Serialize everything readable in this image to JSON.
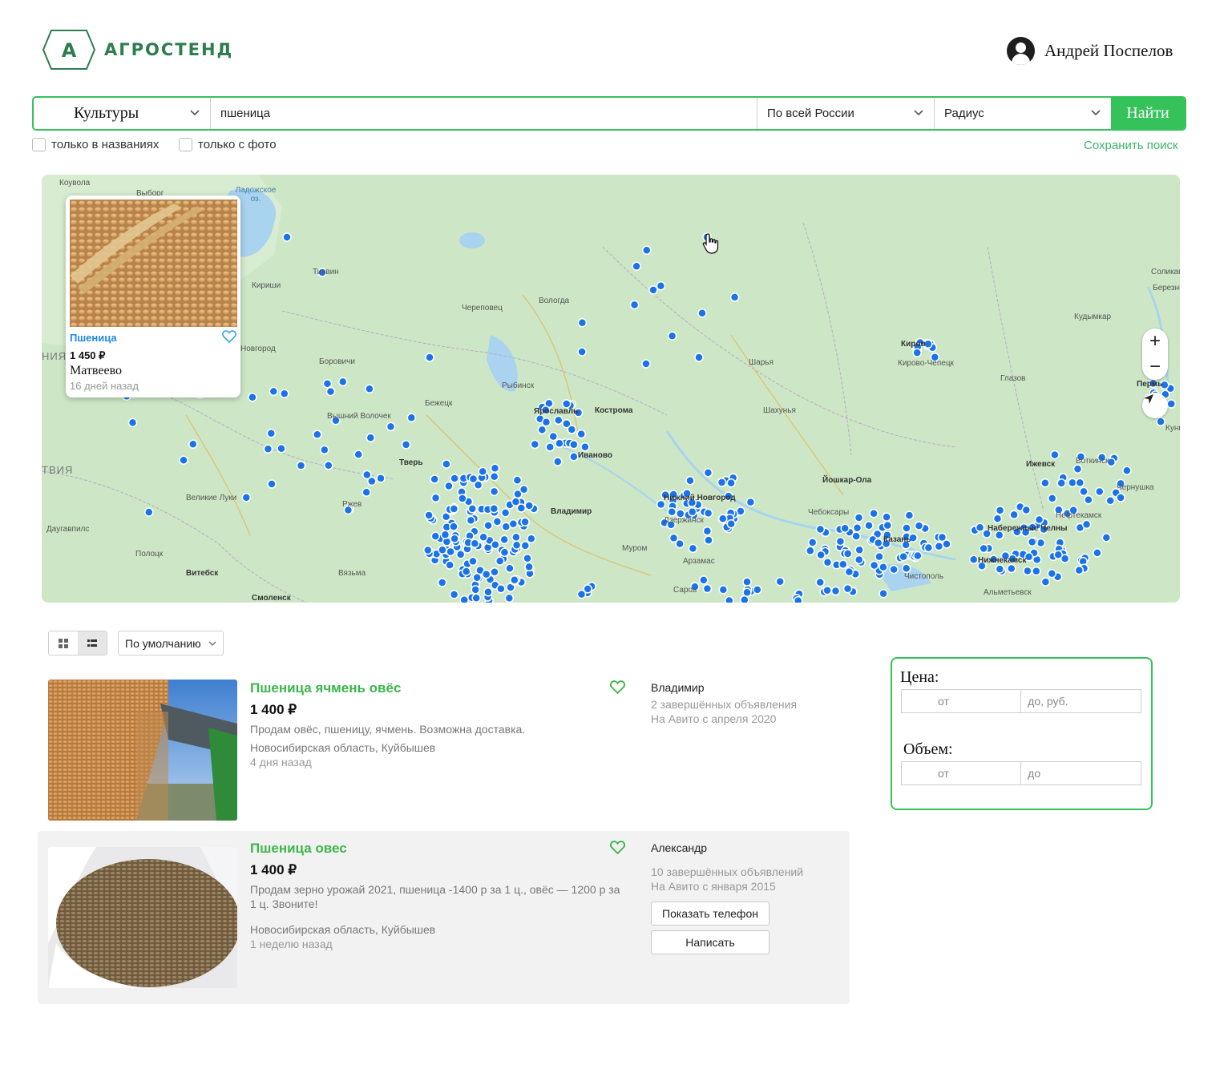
{
  "header": {
    "logo_letter": "А",
    "logo_text": "АГРОСТЕНД",
    "user_name": "Андрей Поспелов"
  },
  "search": {
    "category": "Культуры",
    "query": "пшеница",
    "region": "По всей России",
    "radius": "Радиус",
    "submit": "Найти",
    "only_titles": "только в названиях",
    "only_photo": "только с фото",
    "save_search": "Сохранить поиск"
  },
  "map": {
    "labels": {
      "koivula": "Коувола",
      "vyborg": "Выборг",
      "ladoga": "Ладожское оз.",
      "tikhvin": "Тихвин",
      "kirishi": "Кириши",
      "cherepovets": "Череповец",
      "vologda": "Вологда",
      "novgorod": "Новгород",
      "borovichi": "Боровичи",
      "rybinsk": "Рыбинск",
      "bezhetsk": "Бежецк",
      "vyshny": "Вышний Волочек",
      "yaroslavl": "Ярославль",
      "kostroma": "Кострома",
      "ivanovo": "Иваново",
      "tver": "Тверь",
      "velikie_luki": "Великие Луки",
      "rzhev": "Ржев",
      "vladimir": "Владимир",
      "nn": "Нижний Новгород",
      "dzerzhinsk": "Дзержинск",
      "murom": "Муром",
      "arzamas": "Арзамас",
      "sarov": "Саров",
      "vitebsk": "Витебск",
      "vyazma": "Вязьма",
      "daugavpils": "Даугавпилс",
      "polotsk": "Полоцк",
      "latvia": "ТВИЯ",
      "estonia": "НИЯ",
      "kirov": "Киров",
      "kirovo_chepetsk": "Кирово-Чепецк",
      "sharya": "Шарья",
      "shakhunya": "Шахунья",
      "yoshkar_ola": "Йошкар-Ола",
      "cheboksary": "Чебоксары",
      "kazan": "Казань",
      "chistopol": "Чистополь",
      "glazov": "Глазов",
      "izhevsk": "Ижевск",
      "votkinsk": "Воткинск",
      "chernushka": "Чернушка",
      "neftekamsk": "Нефтекамск",
      "nab_chelny": "Набережные Челны",
      "nizhnekamsk": "Нижнекамск",
      "almetyevsk": "Альметьевск",
      "kudymkar": "Кудымкар",
      "perm": "Пермь",
      "solikamsk": "Соликамск",
      "berezniki": "Березники",
      "kungur": "Кунгур",
      "smolensk": "Смоленск"
    },
    "popup": {
      "title": "Пшеница",
      "price": "1 450 ₽",
      "place": "Матвеево",
      "date": "16 дней назад"
    },
    "zoom_in": "+",
    "zoom_out": "−"
  },
  "list": {
    "sort": "По умолчанию",
    "items": [
      {
        "title": "Пшеница ячмень овёс",
        "price": "1 400 ₽",
        "description": "Продам овёс, пшеницу, ячмень. Возможна доставка.",
        "location": "Новосибирская область, Куйбышев",
        "age": "4 дня назад",
        "seller": "Владимир",
        "seller_ads": "2 завершённых объявления",
        "seller_since": "На Авито с апреля 2020"
      },
      {
        "title": "Пшеница овес",
        "price": "1 400 ₽",
        "description": "Продам зерно урожай 2021, пшеница -1400 р за 1 ц., овёс — 1200 р за 1 ц. Звоните!",
        "location": "Новосибирская область, Куйбышев",
        "age": "1 неделю назад",
        "seller": "Александр",
        "seller_ads": "10 завершённых объявлений",
        "seller_since": "На Авито с января 2015",
        "show_phone": "Показать телефон",
        "write": "Написать"
      }
    ]
  },
  "filter": {
    "price_label": "Цена:",
    "price_from": "от",
    "price_to": "до, руб.",
    "volume_label": "Объем:",
    "volume_from": "от",
    "volume_to": "до"
  },
  "colors": {
    "accent": "#36c25b",
    "brand": "#2e7d4f",
    "marker": "#1a73e8",
    "map_bg": "#cbe6c4"
  }
}
